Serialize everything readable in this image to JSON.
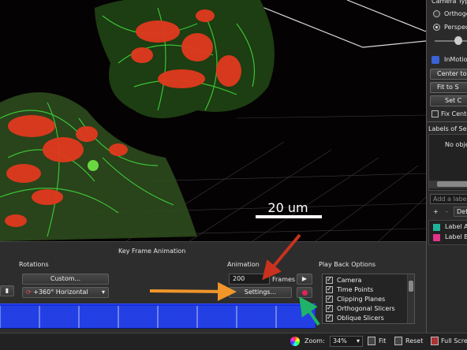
{
  "viewport": {
    "scale_label": "20 um"
  },
  "right_panel": {
    "camera_type": "Camera Type",
    "orthographic": "Orthogonal",
    "perspective": "Perspective",
    "inmotion": "InMotion",
    "center_btn": "Center to",
    "fit_btn": "Fit to S",
    "set_btn": "Set C",
    "fix_center": "Fix Cente",
    "labels_header": "Labels of Selec",
    "no_objects": "No obje",
    "add_label_placeholder": "Add a label",
    "plus": "+",
    "minus": "-",
    "default_select": "Defa",
    "label_a": "Label A",
    "label_b": "Label B",
    "label_a_color": "#1fb39a",
    "label_b_color": "#e0338a"
  },
  "keyframe": {
    "title": "Key Frame Animation",
    "rotations_header": "Rotations",
    "custom_btn": "Custom...",
    "rotation_select": "+360° Horizontal",
    "animation_header": "Animation",
    "frames_value": "200",
    "frames_label": "Frames",
    "settings_btn": "Settings...",
    "playback_header": "Play Back Options",
    "playback_items": [
      {
        "label": "Camera",
        "checked": true
      },
      {
        "label": "Time Points",
        "checked": true
      },
      {
        "label": "Clipping Planes",
        "checked": true
      },
      {
        "label": "Orthogonal Slicers",
        "checked": true
      },
      {
        "label": "Oblique Slicers",
        "checked": true
      }
    ]
  },
  "status_bar": {
    "zoom_label": "Zoom:",
    "zoom_value": "34%",
    "fit_btn": "Fit",
    "reset_btn": "Reset",
    "fullscreen_btn": "Full Scree"
  },
  "colors": {
    "timeline": "#1330d8",
    "arrow_red": "#c8321e",
    "arrow_orange": "#f0962a",
    "arrow_green": "#1fb36a"
  },
  "icons": [
    "play-icon",
    "record-icon",
    "color-wheel-icon",
    "fit-icon",
    "reset-icon",
    "fullscreen-icon",
    "rotation-icon",
    "step-end-icon"
  ]
}
